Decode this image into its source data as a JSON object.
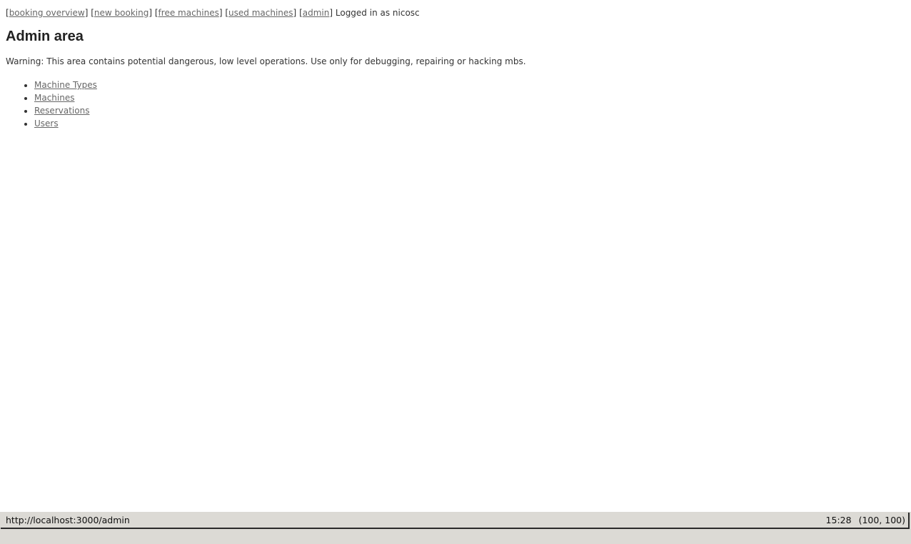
{
  "nav": {
    "links": [
      {
        "label": "booking overview"
      },
      {
        "label": "new booking"
      },
      {
        "label": "free machines"
      },
      {
        "label": "used machines"
      },
      {
        "label": "admin"
      }
    ],
    "logged_in_text": "Logged in as nicosc"
  },
  "main": {
    "title": "Admin area",
    "warning": "Warning: This area contains potential dangerous, low level operations. Use only for debugging, repairing or hacking mbs.",
    "links": [
      {
        "label": "Machine Types"
      },
      {
        "label": "Machines"
      },
      {
        "label": "Reservations"
      },
      {
        "label": "Users"
      }
    ]
  },
  "statusbar": {
    "url": "http://localhost:3000/admin",
    "time": "15:28",
    "coords": "(100, 100)"
  }
}
